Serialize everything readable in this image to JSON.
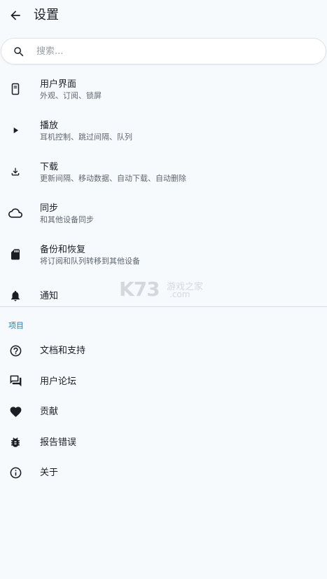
{
  "header": {
    "title": "设置",
    "back_icon": "arrow-left-icon"
  },
  "search": {
    "placeholder": "搜索...",
    "value": "",
    "icon": "search-icon"
  },
  "settings": [
    {
      "icon": "phone-icon",
      "title": "用户界面",
      "subtitle": "外观、订阅、锁屏"
    },
    {
      "icon": "play-icon",
      "title": "播放",
      "subtitle": "耳机控制、跳过间隔、队列"
    },
    {
      "icon": "download-icon",
      "title": "下载",
      "subtitle": "更新间隔、移动数据、自动下载、自动删除"
    },
    {
      "icon": "cloud-icon",
      "title": "同步",
      "subtitle": "和其他设备同步"
    },
    {
      "icon": "sd-card-icon",
      "title": "备份和恢复",
      "subtitle": "将订阅和队列转移到其他设备"
    },
    {
      "icon": "bell-icon",
      "title": "通知",
      "subtitle": ""
    }
  ],
  "project": {
    "header": "项目",
    "items": [
      {
        "icon": "help-circle-icon",
        "label": "文档和支持"
      },
      {
        "icon": "forum-icon",
        "label": "用户论坛"
      },
      {
        "icon": "heart-icon",
        "label": "贡献"
      },
      {
        "icon": "bug-icon",
        "label": "报告错误"
      },
      {
        "icon": "info-icon",
        "label": "关于"
      }
    ]
  },
  "watermark": {
    "logo": "K73",
    "name": "游戏之家",
    "domain": ".com"
  },
  "colors": {
    "background": "#f7fafd",
    "accent": "#1f7fa8",
    "text": "#1b1f24",
    "secondary_text": "#5f6670"
  }
}
